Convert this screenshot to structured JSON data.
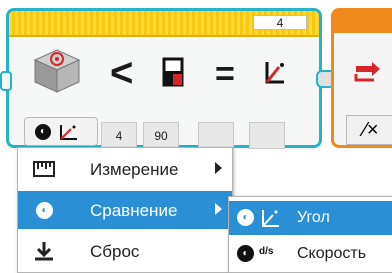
{
  "block": {
    "port": "4",
    "inputs": [
      {
        "value": "4"
      },
      {
        "value": "90"
      },
      {
        "value": ""
      },
      {
        "value": ""
      }
    ]
  },
  "next_block": {
    "button_symbol": "⁄×"
  },
  "menu": {
    "items": [
      {
        "label": "Измерение",
        "icon": "measure-icon",
        "has_submenu": true
      },
      {
        "label": "Сравнение",
        "icon": "compare-mode-icon",
        "has_submenu": true,
        "active": true
      },
      {
        "label": "Сброс",
        "icon": "reset-download-icon",
        "has_submenu": false
      }
    ]
  },
  "submenu": {
    "items": [
      {
        "label": "Угол",
        "icon": "angle-icon",
        "active": true
      },
      {
        "label": "Скорость",
        "icon": "speed-icon",
        "icon_text": "d/s"
      }
    ]
  },
  "colors": {
    "block_border": "#26b3c9",
    "block_topbar": "#f6c90f",
    "next_block": "#f08a1c",
    "menu_highlight": "#2b8fd6"
  }
}
